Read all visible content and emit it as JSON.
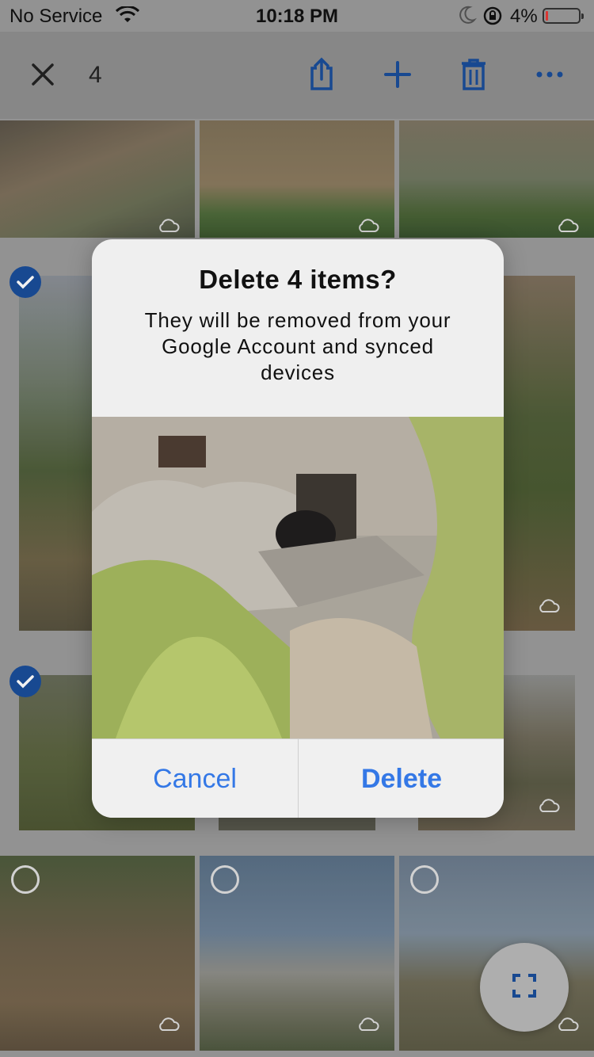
{
  "status_bar": {
    "carrier": "No Service",
    "time": "10:18 PM",
    "battery_percent": "4%",
    "battery_level": 0.04
  },
  "toolbar": {
    "selected_count": "4",
    "icons": [
      "close-icon",
      "share-icon",
      "add-icon",
      "trash-icon",
      "more-icon"
    ]
  },
  "grid": {
    "rows": [
      {
        "items": [
          {
            "selected": null,
            "cloud": true
          },
          {
            "selected": null,
            "cloud": true
          },
          {
            "selected": null,
            "cloud": true
          }
        ]
      },
      {
        "items": [
          {
            "selected": true,
            "cloud": false
          },
          {
            "selected": null,
            "cloud": false
          },
          {
            "selected": null,
            "cloud": true
          }
        ]
      },
      {
        "items": [
          {
            "selected": true,
            "cloud": false
          },
          {
            "selected": null,
            "cloud": false
          },
          {
            "selected": null,
            "cloud": true
          }
        ]
      },
      {
        "items": [
          {
            "selected": false,
            "cloud": true
          },
          {
            "selected": false,
            "cloud": true
          },
          {
            "selected": false,
            "cloud": true
          }
        ]
      }
    ]
  },
  "dialog": {
    "title": "Delete 4 items?",
    "message": "They will be removed from your Google Account and synced devices",
    "cancel_label": "Cancel",
    "delete_label": "Delete"
  },
  "colors": {
    "accent": "#3478e6",
    "toolbar_icon": "#1a4d99",
    "check": "#1a4d99"
  }
}
